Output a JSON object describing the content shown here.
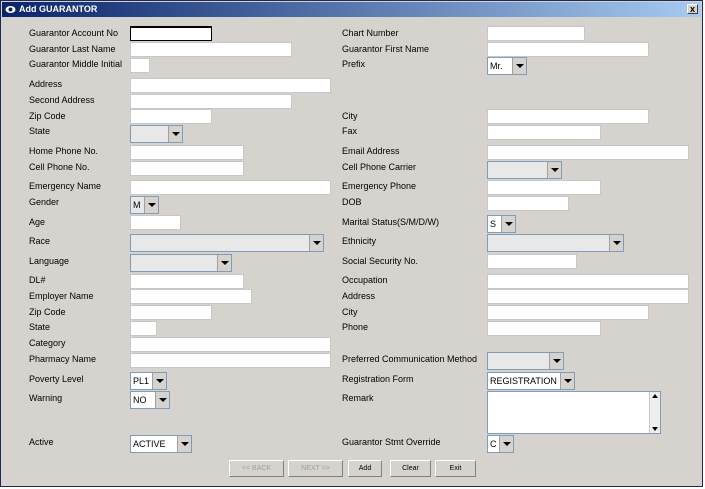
{
  "window": {
    "title": "Add GUARANTOR",
    "close": "x"
  },
  "left": {
    "account_no": "Guarantor Account No",
    "last_name": "Guarantor Last Name",
    "middle_initial": "Guarantor Middle Initial",
    "address": "Address",
    "second_address": "Second Address",
    "zip": "Zip Code",
    "state": "State",
    "home_phone": "Home Phone No.",
    "cell_phone": "Cell Phone No.",
    "emergency_name": "Emergency Name",
    "gender": "Gender",
    "age": "Age",
    "race": "Race",
    "language": "Language",
    "dl": "DL#",
    "employer_name": "Employer Name",
    "emp_zip": "Zip Code",
    "emp_state": "State",
    "category": "Category",
    "pharmacy": "Pharmacy Name",
    "poverty": "Poverty Level",
    "warning": "Warning",
    "active": "Active"
  },
  "right": {
    "chart_number": "Chart Number",
    "first_name": "Guarantor First Name",
    "prefix": "Prefix",
    "city": "City",
    "fax": "Fax",
    "email": "Email Address",
    "carrier": "Cell Phone Carrier",
    "emergency_phone": "Emergency Phone",
    "dob": "DOB",
    "marital": "Marital Status(S/M/D/W)",
    "ethnicity": "Ethnicity",
    "ssn": "Social Security No.",
    "occupation": "Occupation",
    "emp_address": "Address",
    "emp_city": "City",
    "emp_phone": "Phone",
    "preferred_comm": "Preferred Communication Method",
    "registration_form": "Registration Form",
    "remark": "Remark",
    "stmt_override": "Guarantor Stmt Override"
  },
  "values": {
    "prefix": "Mr.",
    "gender": "M",
    "marital": "S",
    "poverty": "PL1",
    "warning": "NO",
    "registration": "REGISTRATION",
    "active": "ACTIVE",
    "stmt_override": "C"
  },
  "buttons": {
    "back": "<< BACK",
    "next": "NEXT >>",
    "add": "Add",
    "clear": "Clear",
    "exit": "Exit"
  }
}
